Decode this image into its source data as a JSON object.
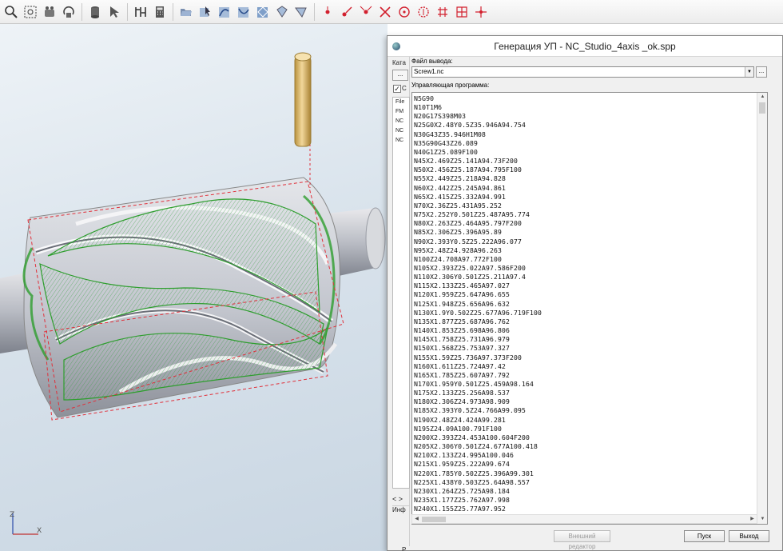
{
  "dialog": {
    "title": "Генерация УП - NC_Studio_4axis _ok.spp",
    "output_file_label": "Файл вывода:",
    "output_file_value": "Screw1.nc",
    "browse_label": "...",
    "program_label": "Управляющая программа:",
    "buttons": {
      "external_editor": "Внешний редактор",
      "start": "Пуск",
      "exit": "Выход"
    },
    "side": {
      "catalog_label": "Ката",
      "checkbox_label": "С",
      "list_header": "File",
      "list_items": [
        "FM",
        "NC",
        "NC",
        "NC"
      ],
      "nav": "< >",
      "info_label": "Инф",
      "p_label": "P"
    },
    "program_lines": [
      "N5G90",
      "N10T1M6",
      "N20G17S398M03",
      "N25G0X2.48Y0.5Z35.946A94.754",
      "N30G43Z35.946H1M08",
      "N35G90G43Z26.089",
      "N40G1Z25.089F100",
      "N45X2.469Z25.141A94.73F200",
      "N50X2.456Z25.187A94.795F100",
      "N55X2.449Z25.218A94.828",
      "N60X2.442Z25.245A94.861",
      "N65X2.415Z25.332A94.991",
      "N70X2.36Z25.431A95.252",
      "N75X2.252Y0.501Z25.487A95.774",
      "N80X2.263Z25.464A95.797F200",
      "N85X2.306Z25.396A95.89",
      "N90X2.393Y0.5Z25.222A96.077",
      "N95X2.48Z24.928A96.263",
      "N100Z24.708A97.772F100",
      "N105X2.393Z25.022A97.586F200",
      "N110X2.306Y0.501Z25.211A97.4",
      "N115X2.133Z25.465A97.027",
      "N120X1.959Z25.647A96.655",
      "N125X1.948Z25.656A96.632",
      "N130X1.9Y0.502Z25.677A96.719F100",
      "N135X1.877Z25.687A96.762",
      "N140X1.853Z25.698A96.806",
      "N145X1.758Z25.731A96.979",
      "N150X1.568Z25.753A97.327",
      "N155X1.59Z25.736A97.373F200",
      "N160X1.611Z25.724A97.42",
      "N165X1.785Z25.607A97.792",
      "N170X1.959Y0.501Z25.459A98.164",
      "N175X2.133Z25.256A98.537",
      "N180X2.306Z24.973A98.909",
      "N185X2.393Y0.5Z24.766A99.095",
      "N190X2.48Z24.424A99.281",
      "N195Z24.09A100.791F100",
      "N200X2.393Z24.453A100.604F200",
      "N205X2.306Y0.501Z24.677A100.418",
      "N210X2.133Z24.995A100.046",
      "N215X1.959Z25.222A99.674",
      "N220X1.785Y0.502Z25.396A99.301",
      "N225X1.438Y0.503Z25.64A98.557",
      "N230X1.264Z25.725A98.184",
      "N235X1.177Z25.762A97.998",
      "N240X1.155Z25.77A97.952"
    ]
  },
  "viewport": {
    "axis_z": "Z",
    "axis_x": "X",
    "colors": {
      "background": "#d9e3ec",
      "toolpath": "#2e9e2e",
      "tool": "#e3c27a",
      "boundary": "#e0303a"
    }
  },
  "toolbar": {
    "icons": [
      "zoom-icon",
      "zoom-window-icon",
      "pan-icon",
      "rotate-icon",
      "separator",
      "stock-icon",
      "select-icon",
      "separator",
      "grid-icon",
      "calculator-icon",
      "separator",
      "open-folder-icon",
      "cursor-edit-icon",
      "curve-a-icon",
      "curve-b-icon",
      "curve-c-icon",
      "curve-d-icon",
      "curve-e-icon",
      "separator",
      "point-icon",
      "point-add-icon",
      "point-move-icon",
      "point-delete-icon",
      "circle-point-icon",
      "circle-target-icon",
      "grid-point-icon",
      "grid-snap-icon",
      "axis-point-icon"
    ]
  }
}
